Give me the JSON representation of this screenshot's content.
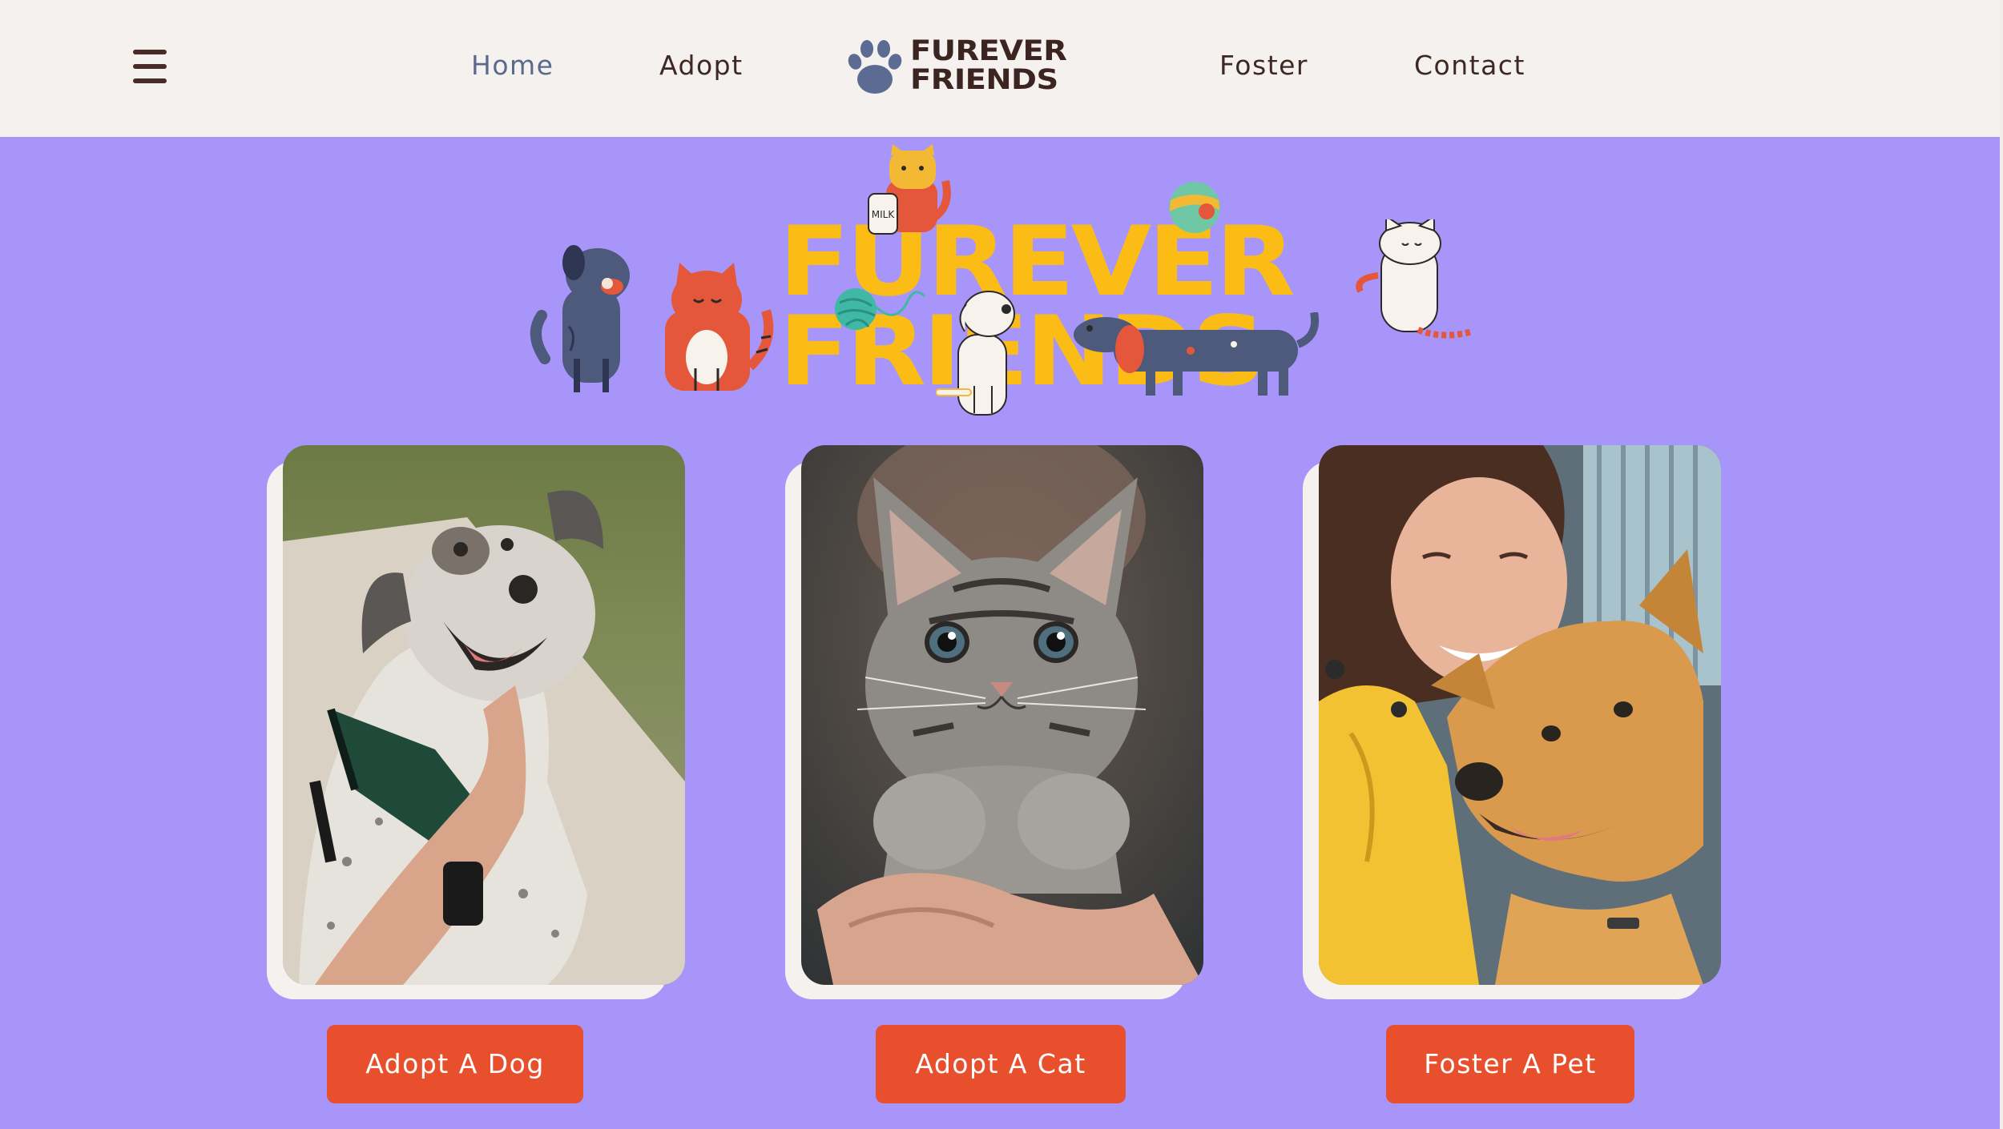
{
  "header": {
    "menu_icon": "hamburger-menu-icon",
    "nav_left": [
      {
        "label": "Home",
        "active": true
      },
      {
        "label": "Adopt",
        "active": false
      }
    ],
    "nav_right": [
      {
        "label": "Foster",
        "active": false
      },
      {
        "label": "Contact",
        "active": false
      }
    ],
    "brand": {
      "line1": "FUREVER",
      "line2": "FRIENDS",
      "icon": "paw-icon"
    }
  },
  "hero": {
    "line1": "FUREVER",
    "line2": "FRIENDS",
    "bottle_label": "MILK"
  },
  "cards": [
    {
      "image": "smiling spotted dog with bandana being petted",
      "button_label": "Adopt A Dog"
    },
    {
      "image": "tabby kitten held in a hand",
      "button_label": "Adopt A Cat"
    },
    {
      "image": "woman in yellow jacket hugging a dog",
      "button_label": "Foster A Pet"
    }
  ],
  "colors": {
    "page_background": "#a895f9",
    "header_background": "#f5f1ee",
    "accent_button": "#e8502d",
    "hero_title": "#fbbd15",
    "nav_text": "#3e2823",
    "nav_active": "#5a6a8e"
  }
}
